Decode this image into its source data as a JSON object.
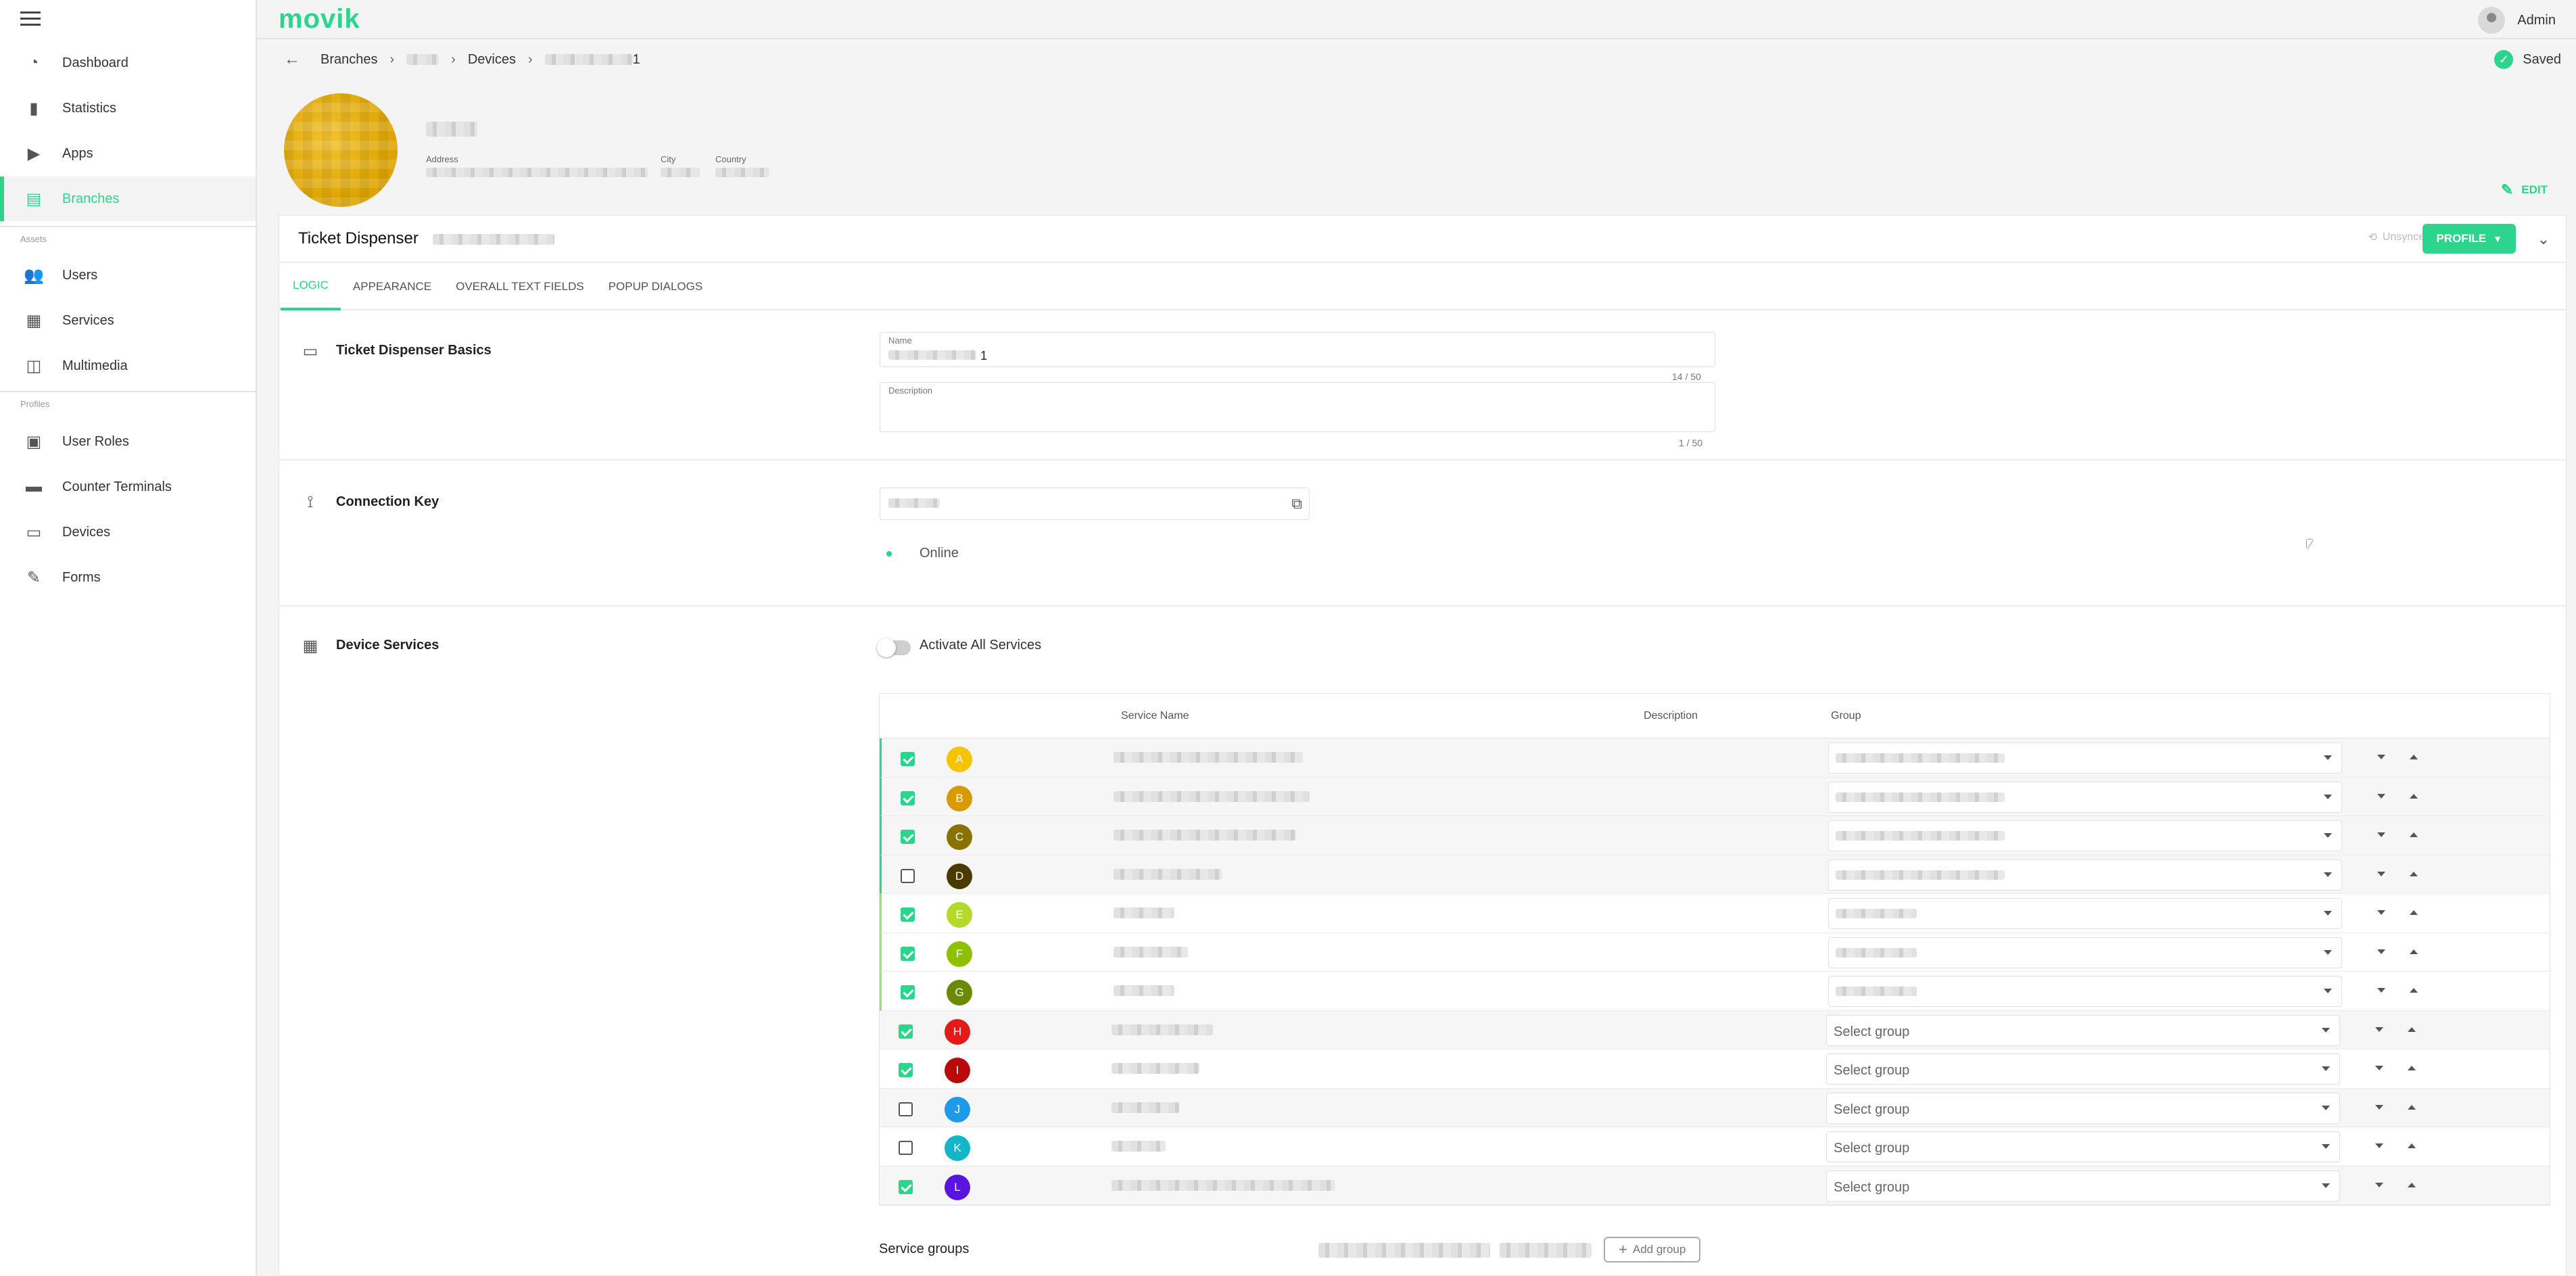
{
  "brand": {
    "logo": "movik",
    "accent": "#2bd58b"
  },
  "user": {
    "name": "Admin"
  },
  "sidebar": {
    "items": [
      {
        "label": "Dashboard",
        "icon": "dashboard-icon"
      },
      {
        "label": "Statistics",
        "icon": "bar-chart-icon"
      },
      {
        "label": "Apps",
        "icon": "play-icon"
      },
      {
        "label": "Branches",
        "icon": "store-icon",
        "active": true
      },
      {
        "label": "Users",
        "icon": "people-icon"
      },
      {
        "label": "Services",
        "icon": "clipboard-icon"
      },
      {
        "label": "Multimedia",
        "icon": "media-icon"
      },
      {
        "label": "User Roles",
        "icon": "badge-icon"
      },
      {
        "label": "Counter Terminals",
        "icon": "briefcase-icon"
      },
      {
        "label": "Devices",
        "icon": "devices-icon"
      },
      {
        "label": "Forms",
        "icon": "form-icon"
      }
    ],
    "sections": {
      "assets": "Assets",
      "profiles": "Profiles"
    }
  },
  "breadcrumb": {
    "root": "Branches",
    "devices": "Devices",
    "current_suffix": "1"
  },
  "status": {
    "saved": "Saved"
  },
  "branch": {
    "address_label": "Address",
    "city_label": "City",
    "country_label": "Country",
    "edit_label": "EDIT"
  },
  "device": {
    "title": "Ticket Dispenser",
    "unsynced": "Unsynced",
    "profile_button": "PROFILE"
  },
  "tabs": [
    "LOGIC",
    "APPEARANCE",
    "OVERALL TEXT FIELDS",
    "POPUP DIALOGS"
  ],
  "basics": {
    "title": "Ticket Dispenser Basics",
    "name_label": "Name",
    "name_value_suffix": "1",
    "name_counter": "14 / 50",
    "description_label": "Description",
    "description_counter": "1 / 50"
  },
  "connection": {
    "title": "Connection Key",
    "status": "Online"
  },
  "services": {
    "title": "Device Services",
    "activate_all": "Activate All Services",
    "columns": {
      "name": "Service Name",
      "description": "Description",
      "group": "Group"
    },
    "rows": [
      {
        "letter": "A",
        "color": "#f5c400",
        "checked": true,
        "group": null
      },
      {
        "letter": "B",
        "color": "#d79a00",
        "checked": true,
        "group": null
      },
      {
        "letter": "C",
        "color": "#8a7200",
        "checked": true,
        "group": null
      },
      {
        "letter": "D",
        "color": "#4a3a00",
        "checked": false,
        "group": null
      },
      {
        "letter": "E",
        "color": "#b5d92a",
        "checked": true,
        "group": null
      },
      {
        "letter": "F",
        "color": "#8fc000",
        "checked": true,
        "group": null
      },
      {
        "letter": "G",
        "color": "#6b8a00",
        "checked": true,
        "group": null
      },
      {
        "letter": "H",
        "color": "#e21a1a",
        "checked": true,
        "group": "Select group"
      },
      {
        "letter": "I",
        "color": "#b80a0a",
        "checked": true,
        "group": "Select group"
      },
      {
        "letter": "J",
        "color": "#1e9ae8",
        "checked": false,
        "group": "Select group"
      },
      {
        "letter": "K",
        "color": "#12b6c8",
        "checked": false,
        "group": "Select group"
      },
      {
        "letter": "L",
        "color": "#5a14e0",
        "checked": true,
        "group": "Select group"
      }
    ]
  },
  "service_groups": {
    "label": "Service groups",
    "add_button": "Add group"
  }
}
